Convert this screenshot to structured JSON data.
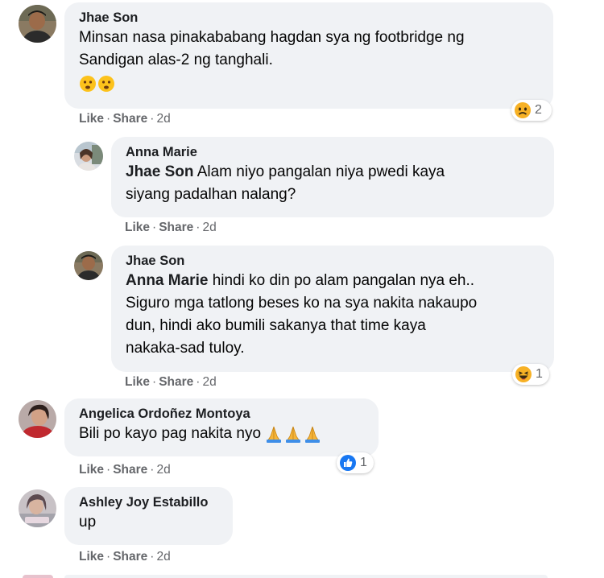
{
  "comments": [
    {
      "author": "Jhae Son",
      "text": [
        "Minsan nasa pinakababang hagdan sya ng footbridge ng",
        "Sandigan alas-2 ng tanghali."
      ],
      "emoji": "😦😦",
      "like": "Like",
      "share": "Share",
      "sep": "·",
      "time": "2d",
      "reaction": {
        "icon": "sad-reaction-icon",
        "count": "2"
      }
    },
    {
      "author": "Anna Marie",
      "mention": "Jhae Son",
      "text": [
        " Alam niyo pangalan niya pwedi kaya",
        "siyang padalhan nalang?"
      ],
      "like": "Like",
      "share": "Share",
      "sep": "·",
      "time": "2d"
    },
    {
      "author": "Jhae Son",
      "mention": "Anna Marie",
      "text": [
        " hindi ko din po alam pangalan nya eh..",
        "Siguro mga tatlong beses ko na sya nakita nakaupo",
        "dun, hindi ako bumili sakanya that time kaya",
        "nakaka-sad tuloy."
      ],
      "like": "Like",
      "share": "Share",
      "sep": "·",
      "time": "2d",
      "reaction": {
        "icon": "haha-reaction-icon",
        "count": "1"
      }
    },
    {
      "author": "Angelica Ordoñez Montoya",
      "text": [
        "Bili po kayo pag nakita nyo "
      ],
      "emoji": "🙏🙏🙏",
      "like": "Like",
      "share": "Share",
      "sep": "·",
      "time": "2d",
      "reaction": {
        "icon": "like-reaction-icon",
        "count": "1"
      }
    },
    {
      "author": "Ashley Joy Estabillo",
      "text": [
        "up"
      ],
      "like": "Like",
      "share": "Share",
      "sep": "·",
      "time": "2d"
    }
  ],
  "colors": {
    "bubble": "#f0f2f5",
    "meta": "#65676b",
    "like_blue": "#1877f2",
    "reaction_yellow": "#f7b125"
  }
}
